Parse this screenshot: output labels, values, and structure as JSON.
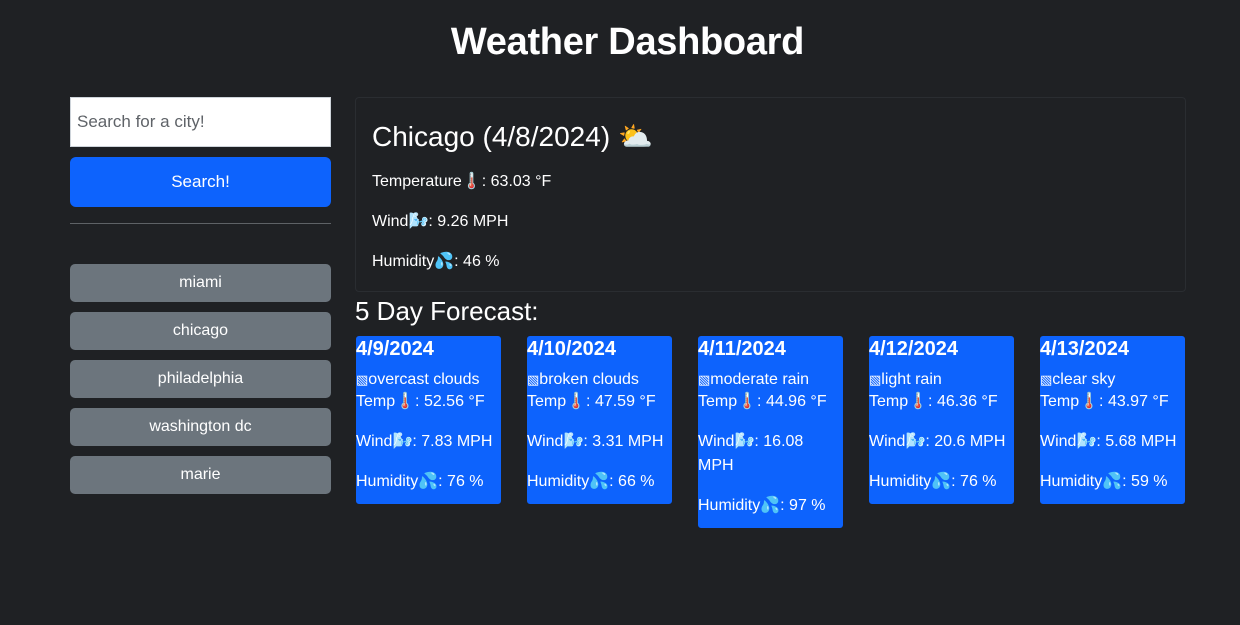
{
  "header": {
    "title": "Weather Dashboard"
  },
  "search": {
    "placeholder": "Search for a city!",
    "value": "",
    "button_label": "Search!"
  },
  "history": [
    "miami",
    "chicago",
    "philadelphia",
    "washington dc",
    "marie"
  ],
  "current": {
    "title": "Chicago (4/8/2024)",
    "icon": "⛅",
    "temp_label": "Temperature🌡️: ",
    "temp_value": "63.03 °F",
    "wind_label": "Wind🌬️: ",
    "wind_value": "9.26 MPH",
    "humidity_label": "Humidity💦: ",
    "humidity_value": "46 %"
  },
  "forecast": {
    "heading": "5 Day Forecast:",
    "days": [
      {
        "date": "4/9/2024",
        "alt": "overcast clouds",
        "temp": "Temp🌡️: 52.56 °F",
        "wind": "Wind🌬️: 7.83 MPH",
        "humidity": "Humidity💦: 76 %"
      },
      {
        "date": "4/10/2024",
        "alt": "broken clouds",
        "temp": "Temp🌡️: 47.59 °F",
        "wind": "Wind🌬️: 3.31 MPH",
        "humidity": "Humidity💦: 66 %"
      },
      {
        "date": "4/11/2024",
        "alt": "moderate rain",
        "temp": "Temp🌡️: 44.96 °F",
        "wind": "Wind🌬️: 16.08 MPH",
        "humidity": "Humidity💦: 97 %"
      },
      {
        "date": "4/12/2024",
        "alt": "light rain",
        "temp": "Temp🌡️: 46.36 °F",
        "wind": "Wind🌬️: 20.6 MPH",
        "humidity": "Humidity💦: 76 %"
      },
      {
        "date": "4/13/2024",
        "alt": "clear sky",
        "temp": "Temp🌡️: 43.97 °F",
        "wind": "Wind🌬️: 5.68 MPH",
        "humidity": "Humidity💦: 59 %"
      }
    ]
  },
  "colors": {
    "background": "#1f2124",
    "primary": "#0d63fd",
    "secondary": "#6c757d",
    "text": "#ffffff"
  }
}
